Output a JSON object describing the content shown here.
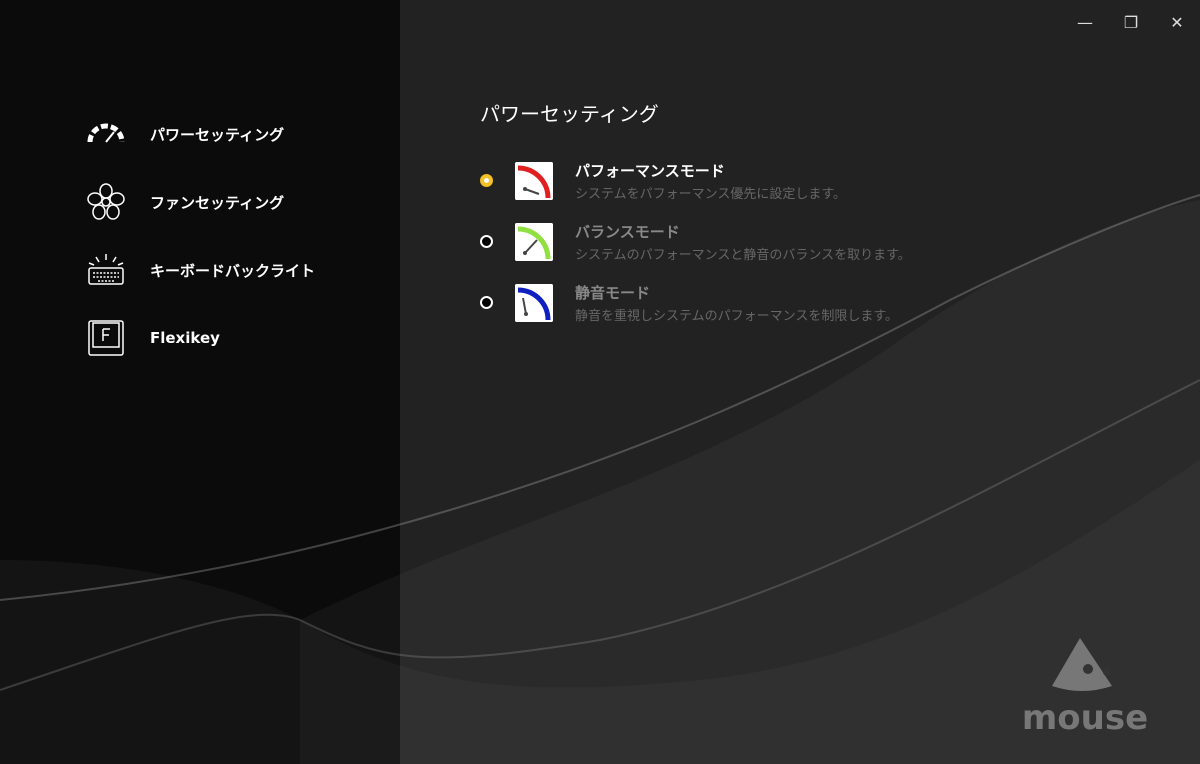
{
  "window": {
    "minimize": "—",
    "restore": "❐",
    "close": "✕"
  },
  "sidebar": {
    "items": [
      {
        "label": "パワーセッティング",
        "icon": "speedometer-icon"
      },
      {
        "label": "ファンセッティング",
        "icon": "fan-icon"
      },
      {
        "label": "キーボードバックライト",
        "icon": "keyboard-backlight-icon"
      },
      {
        "label": "Flexikey",
        "icon": "flexikey-icon"
      }
    ]
  },
  "main": {
    "title": "パワーセッティング",
    "modes": [
      {
        "title": "パフォーマンスモード",
        "desc": "システムをパフォーマンス優先に設定します。",
        "selected": true,
        "color": "#e02020"
      },
      {
        "title": "バランスモード",
        "desc": "システムのパフォーマンスと静音のバランスを取ります。",
        "selected": false,
        "color": "#8fe040"
      },
      {
        "title": "静音モード",
        "desc": "静音を重視しシステムのパフォーマンスを制限します。",
        "selected": false,
        "color": "#1020c0"
      }
    ]
  },
  "brand": {
    "logo_text": "mouse"
  }
}
